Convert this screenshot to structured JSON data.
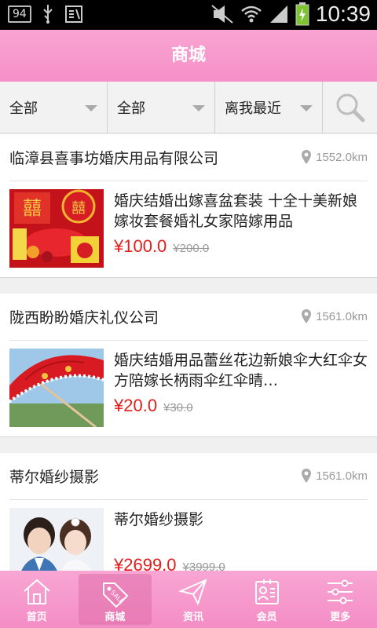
{
  "status_bar": {
    "badge": "94",
    "time": "10:39",
    "icons": [
      "usb-icon",
      "debug-icon",
      "mute-icon",
      "wifi-icon",
      "signal-icon",
      "battery-charging-icon"
    ]
  },
  "header": {
    "title": "商城"
  },
  "filters": [
    {
      "label": "全部"
    },
    {
      "label": "全部"
    },
    {
      "label": "离我最近"
    }
  ],
  "shops": [
    {
      "name": "临漳县喜事坊婚庆用品有限公司",
      "distance": "1552.0km",
      "product": {
        "name": "婚庆结婚出嫁喜盆套装 十全十美新娘嫁妆套餐婚礼女家陪嫁用品",
        "price": "¥100.0",
        "original_price": "¥200.0"
      }
    },
    {
      "name": "陇西盼盼婚庆礼仪公司",
      "distance": "1561.0km",
      "product": {
        "name": "婚庆结婚用品蕾丝花边新娘伞大红伞女方陪嫁长柄雨伞红伞晴…",
        "price": "¥20.0",
        "original_price": "¥30.0"
      }
    },
    {
      "name": "蒂尔婚纱摄影",
      "distance": "1561.0km",
      "product": {
        "name": "蒂尔婚纱摄影",
        "price": "¥2699.0",
        "original_price": "¥3999.0"
      }
    }
  ],
  "tabs": [
    {
      "label": "首页",
      "icon": "home-icon"
    },
    {
      "label": "商城",
      "icon": "sale-tag-icon"
    },
    {
      "label": "资讯",
      "icon": "paper-plane-icon"
    },
    {
      "label": "会员",
      "icon": "member-card-icon"
    },
    {
      "label": "更多",
      "icon": "sliders-icon"
    }
  ],
  "colors": {
    "accent_pink": "#f590c7",
    "price_red": "#e0201c"
  }
}
